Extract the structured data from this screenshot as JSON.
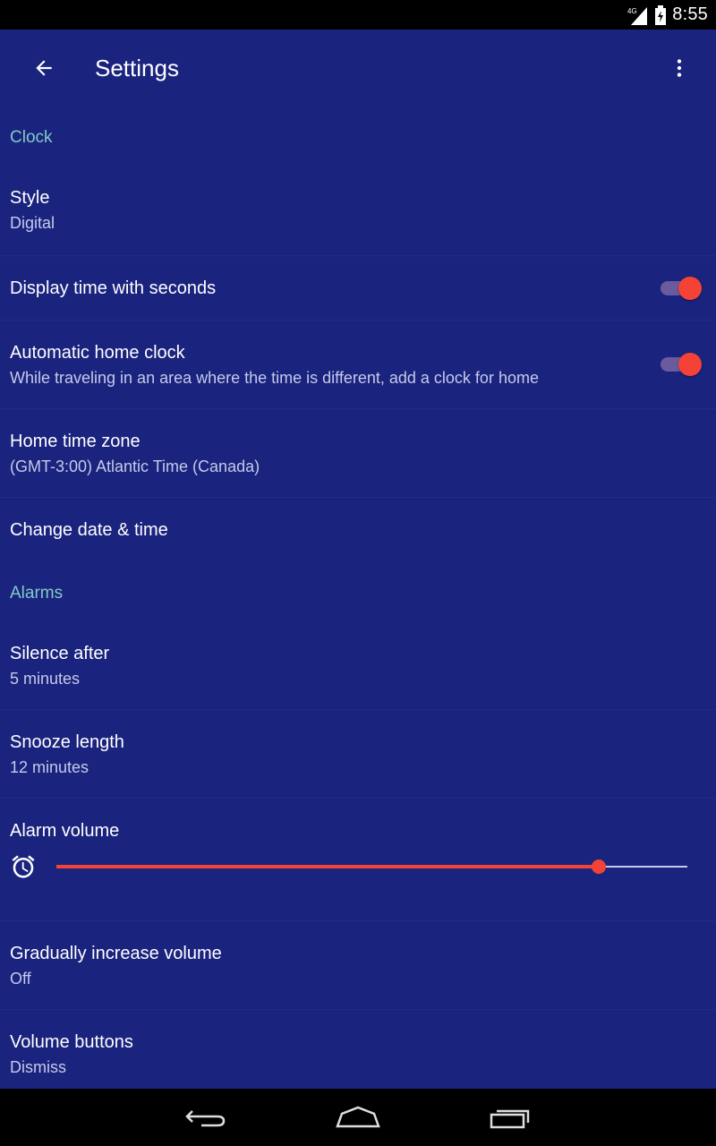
{
  "status_bar": {
    "network": "4G",
    "time": "8:55"
  },
  "app_bar": {
    "title": "Settings",
    "back_icon": "arrow-back-icon",
    "menu_icon": "more-vert-icon"
  },
  "sections": {
    "clock": {
      "header": "Clock",
      "style": {
        "title": "Style",
        "summary": "Digital"
      },
      "seconds": {
        "title": "Display time with seconds",
        "checked": true
      },
      "auto_home": {
        "title": "Automatic home clock",
        "summary": "While traveling in an area where the time is different, add a clock for home",
        "checked": true
      },
      "home_tz": {
        "title": "Home time zone",
        "summary": "(GMT-3:00) Atlantic Time (Canada)"
      },
      "change_dt": {
        "title": "Change date & time"
      }
    },
    "alarms": {
      "header": "Alarms",
      "silence": {
        "title": "Silence after",
        "summary": "5 minutes"
      },
      "snooze": {
        "title": "Snooze length",
        "summary": "12 minutes"
      },
      "volume": {
        "title": "Alarm volume",
        "level": 0.86,
        "icon": "alarm-clock-icon"
      },
      "gradual": {
        "title": "Gradually increase volume",
        "summary": "Off"
      },
      "volume_buttons": {
        "title": "Volume buttons",
        "summary": "Dismiss"
      }
    }
  },
  "colors": {
    "background": "#1a237e",
    "accent": "#f44336",
    "section_header": "#80cbc4"
  },
  "nav_bar": {
    "back_icon": "nav-back-icon",
    "home_icon": "nav-home-icon",
    "recents_icon": "nav-recents-icon"
  }
}
